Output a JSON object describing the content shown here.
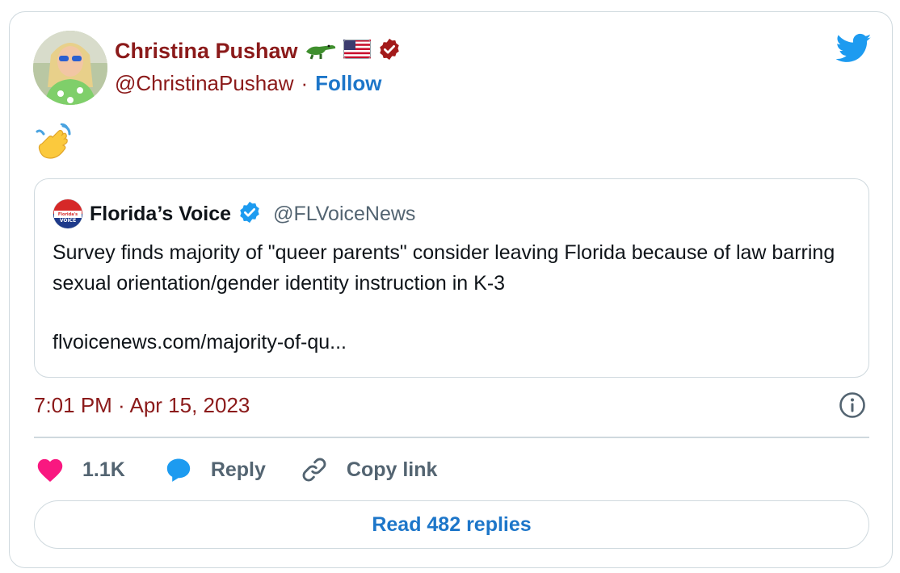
{
  "author": {
    "name": "Christina Pushaw",
    "handle": "@ChristinaPushaw",
    "separator": "·",
    "follow_label": "Follow",
    "badges": [
      "alligator-emoji",
      "us-flag-emoji",
      "verified-badge-icon"
    ]
  },
  "tweet": {
    "emoji": "waving-hand",
    "timestamp": "7:01 PM · Apr 15, 2023"
  },
  "quoted": {
    "name": "Florida’s Voice",
    "handle": "@FLVoiceNews",
    "logo_text_top": "Florida's",
    "logo_text_bottom": "VOICE",
    "text": "Survey finds majority of \"queer parents\" consider leaving Florida because of law barring sexual orientation/gender identity instruction in K-3",
    "link": "flvoicenews.com/majority-of-qu..."
  },
  "actions": {
    "like_count": "1.1K",
    "reply_label": "Reply",
    "copy_label": "Copy link"
  },
  "read_replies_label": "Read 482 replies",
  "colors": {
    "author_red": "#8b1a1a",
    "link_blue": "#1d76c9",
    "twitter_blue": "#1d9bf0",
    "heart": "#f91880",
    "border": "#cfd9de"
  }
}
